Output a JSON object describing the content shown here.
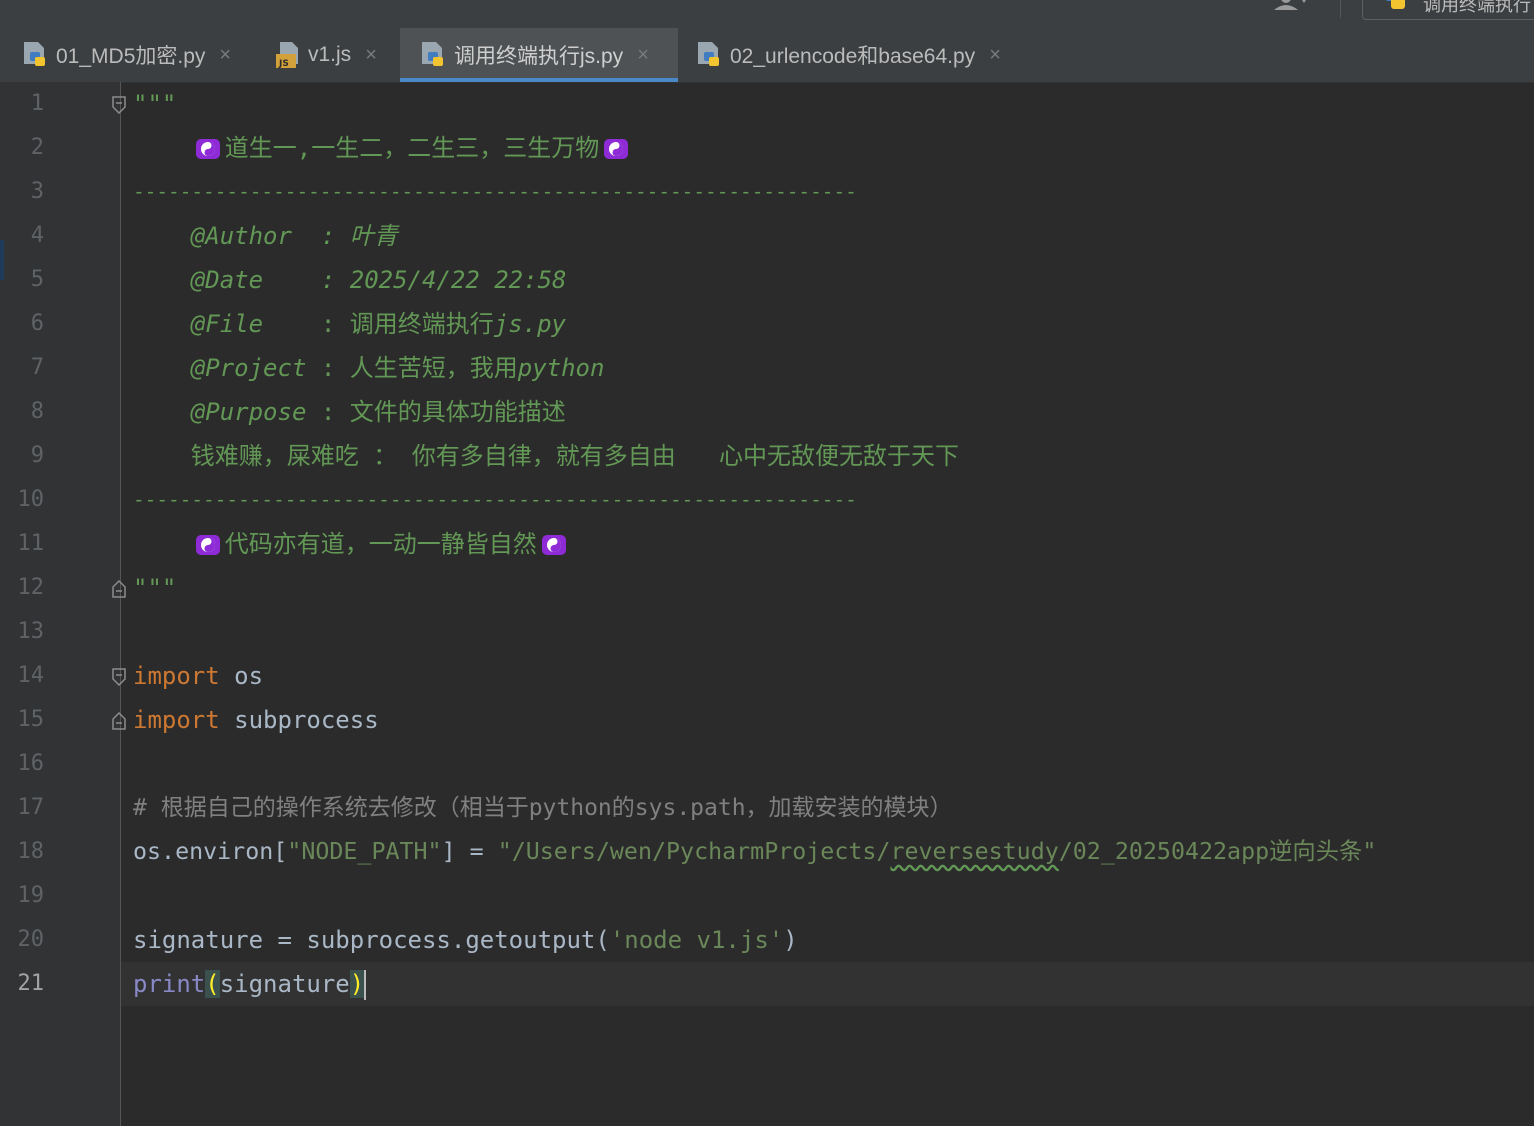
{
  "topbar": {
    "run_config_label": "调用终端执行"
  },
  "tabs": [
    {
      "label": "01_MD5加密.py",
      "icon": "python-file-icon",
      "active": false
    },
    {
      "label": "v1.js",
      "icon": "javascript-file-icon",
      "active": false
    },
    {
      "label": "调用终端执行js.py",
      "icon": "python-file-icon",
      "active": true
    },
    {
      "label": "02_urlencode和base64.py",
      "icon": "python-file-icon",
      "active": false
    }
  ],
  "tab_close_glyph": "×",
  "gutter": {
    "line_numbers": [
      "1",
      "2",
      "3",
      "4",
      "5",
      "6",
      "7",
      "8",
      "9",
      "10",
      "11",
      "12",
      "13",
      "14",
      "15",
      "16",
      "17",
      "18",
      "19",
      "20",
      "21"
    ],
    "current_line": "21"
  },
  "code": {
    "docstring_quote": "\"\"\"",
    "l2_text": "道生一,一生二，二生三，三生万物",
    "separator": "--------------------------------------------------------------",
    "author_key": "@Author",
    "author_val": ": 叶青",
    "date_key": "@Date",
    "date_val": ": 2025/4/22 22:58",
    "file_key": "@File",
    "file_val_cn": ": 调用终端执行",
    "file_val_ext": "js.py",
    "project_key": "@Project",
    "project_val_cn": ": 人生苦短，我用",
    "project_val_en": "python",
    "purpose_key": "@Purpose",
    "purpose_val": ": 文件的具体功能描述",
    "l9_text": "钱难赚，屎难吃 ： 你有多自律，就有多自由   心中无敌便无敌于天下",
    "l11_text": "代码亦有道，一动一静皆自然",
    "kw_import": "import",
    "mod_os": " os",
    "mod_subprocess": " subprocess",
    "comment17": "# 根据自己的操作系统去修改（相当于python的sys.path，加载安装的模块）",
    "l18_a": "os.environ[",
    "l18_key": "\"NODE_PATH\"",
    "l18_b": "] = ",
    "l18_str1": "\"/Users/wen/PycharmProjects/",
    "l18_str2": "reversestudy",
    "l18_str3": "/02_20250422app逆向头条\"",
    "l20_a": "signature = subprocess.getoutput(",
    "l20_str": "'node v1.js'",
    "l20_b": ")",
    "l21_fn": "print",
    "l21_open": "(",
    "l21_arg": "signature",
    "l21_close": ")"
  },
  "colors": {
    "editor_bg": "#2b2b2b",
    "doc_comment": "#629755",
    "keyword": "#cc7832",
    "string": "#6a8759",
    "builtin": "#8888c6",
    "text": "#a9b7c6",
    "active_tab_underline": "#4a88c7"
  }
}
